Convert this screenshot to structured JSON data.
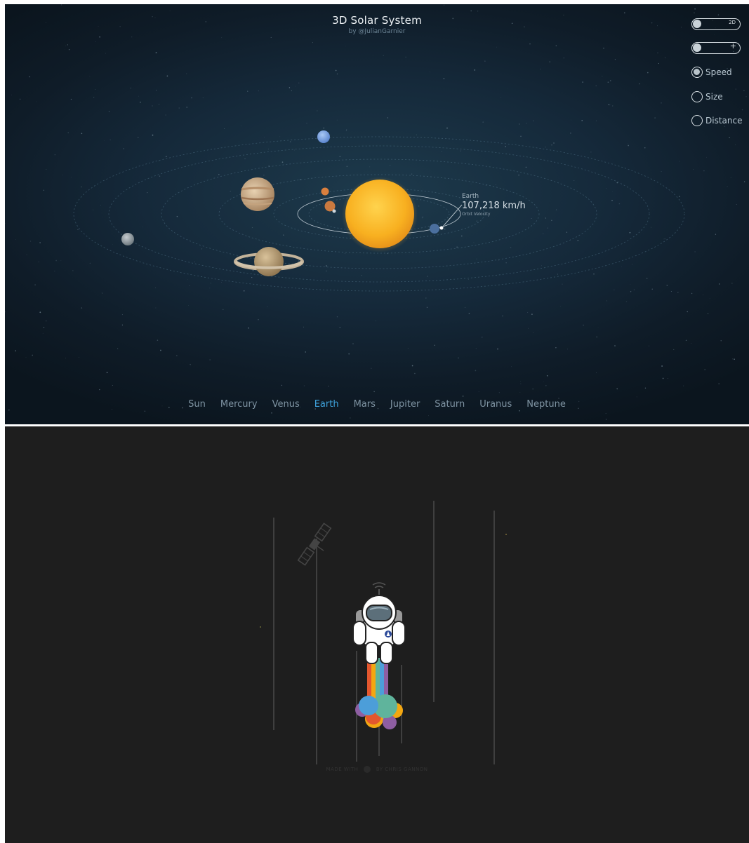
{
  "header": {
    "title": "3D Solar System",
    "byline": "by @JulianGarnier"
  },
  "controls": {
    "toggle_2d_label": "2D",
    "toggle_zoom_label": "+",
    "options": [
      {
        "label": "Speed",
        "selected": true
      },
      {
        "label": "Size",
        "selected": false
      },
      {
        "label": "Distance",
        "selected": false
      }
    ]
  },
  "nav": {
    "items": [
      "Sun",
      "Mercury",
      "Venus",
      "Earth",
      "Mars",
      "Jupiter",
      "Saturn",
      "Uranus",
      "Neptune"
    ],
    "active": "Earth"
  },
  "planet_info": {
    "name": "Earth",
    "value": "107,218 km/h",
    "label": "Orbit Velocity"
  },
  "footer": {
    "made_with": "MADE WITH",
    "by": "BY CHRIS GANNON"
  },
  "colors": {
    "active_nav": "#3fa4de",
    "sun": "#f8b020",
    "astro_bg": "#1e1e1e",
    "rainbow": [
      "#e4572e",
      "#f3a712",
      "#5fb49c",
      "#4c9ed9",
      "#8e5ea2"
    ]
  }
}
